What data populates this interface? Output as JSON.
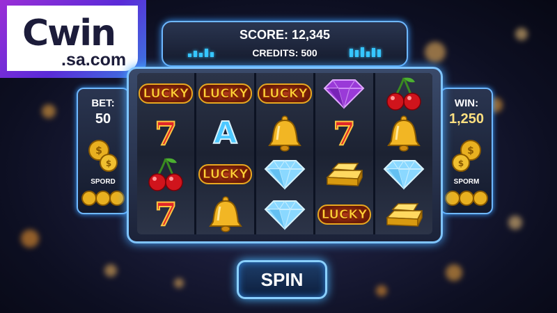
{
  "logo": {
    "big": "Cwin",
    "small": ".sa.com"
  },
  "score": {
    "label": "SCORE: 12,345",
    "credits": "CREDITS: 500"
  },
  "bet": {
    "label": "BET:",
    "value": "50",
    "sub": "SPORD"
  },
  "win": {
    "label": "WIN:",
    "value": "1,250",
    "sub": "SPORM"
  },
  "spin_label": "SPIN",
  "reels": [
    [
      "lucky",
      "seven",
      "cherry",
      "seven"
    ],
    [
      "lucky",
      "letter-a",
      "lucky",
      "bell"
    ],
    [
      "lucky",
      "bell",
      "diamond",
      "diamond"
    ],
    [
      "amethyst",
      "seven",
      "gold-bar",
      "lucky"
    ],
    [
      "cherry",
      "bell",
      "diamond",
      "gold-bar"
    ]
  ],
  "symbols": {
    "lucky_text": "LUCKY",
    "letter_a": "A",
    "seven": "7"
  },
  "colors": {
    "accent": "#6fb8ff",
    "gold": "#ffd43a",
    "red": "#e0262a"
  }
}
